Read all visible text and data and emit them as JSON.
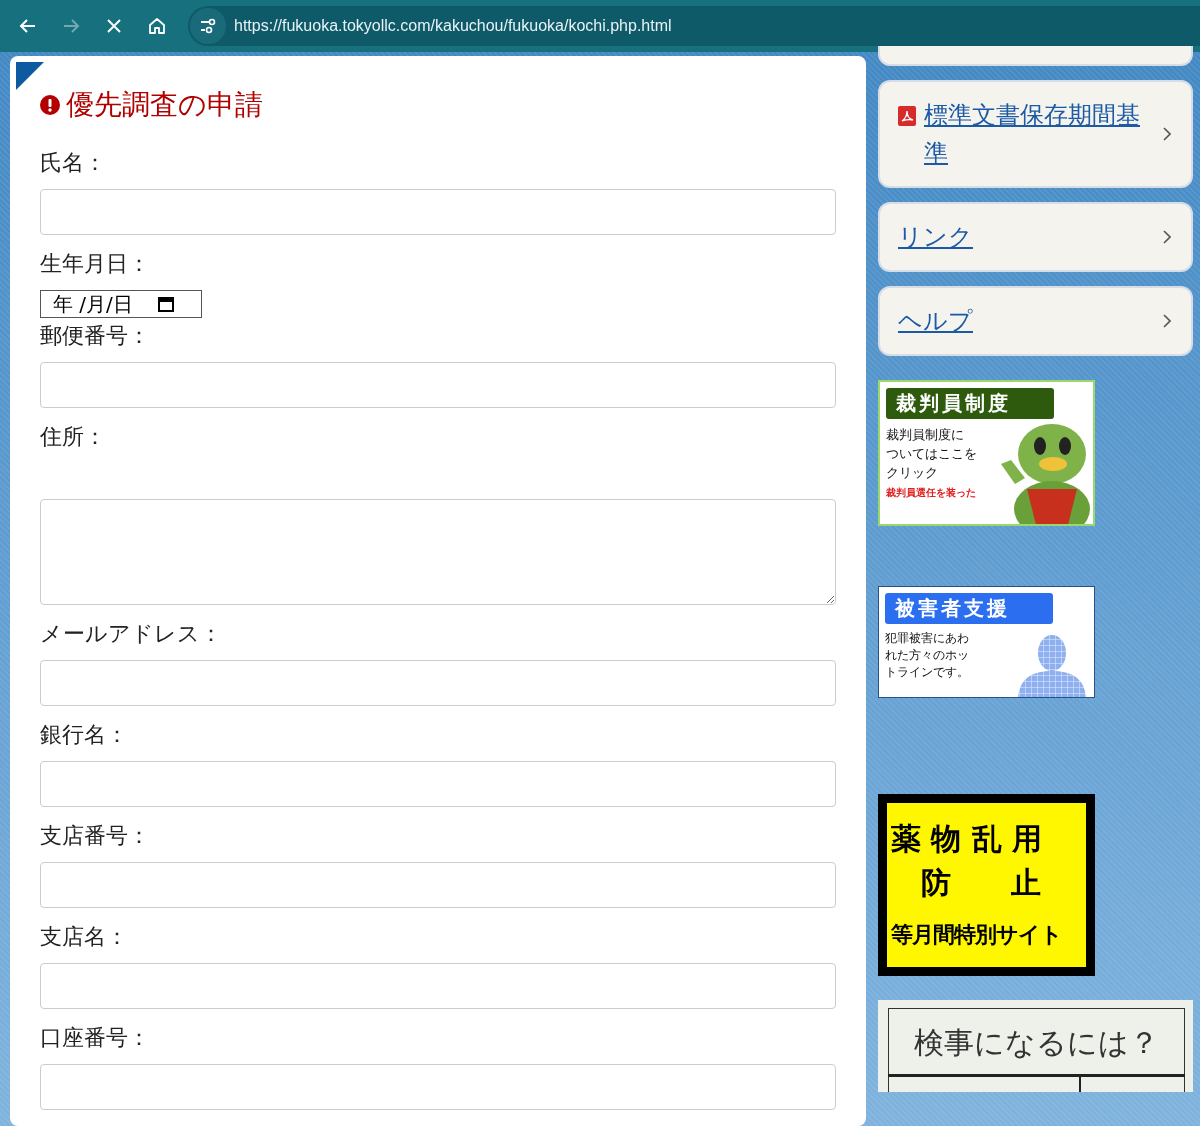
{
  "browser": {
    "url": "https://fukuoka.tokyollc.com/kakuchou/fukuoka/kochi.php.html",
    "forward_disabled": true
  },
  "form": {
    "title": "優先調査の申請",
    "fields": [
      {
        "label": "氏名：",
        "kind": "text"
      },
      {
        "label": "生年月日：",
        "kind": "date",
        "placeholder": "年 /月/日"
      },
      {
        "label": "郵便番号：",
        "kind": "text"
      },
      {
        "label": "住所：",
        "kind": "textarea"
      },
      {
        "label": "メールアドレス：",
        "kind": "text"
      },
      {
        "label": "銀行名：",
        "kind": "text"
      },
      {
        "label": "支店番号：",
        "kind": "text"
      },
      {
        "label": "支店名：",
        "kind": "text"
      },
      {
        "label": "口座番号：",
        "kind": "text"
      }
    ]
  },
  "sidebar": {
    "links": [
      {
        "label": "標準文書保存期間基準",
        "kind": "pdf"
      },
      {
        "label": "リンク",
        "kind": "plain"
      },
      {
        "label": "ヘルプ",
        "kind": "plain"
      }
    ],
    "banners": [
      {
        "kind": "mascot",
        "title": "裁判員制度",
        "lines": [
          "裁判員制度に",
          "ついてはここを",
          "クリック"
        ],
        "note": "裁判員選任を装った"
      },
      {
        "kind": "silhouette",
        "title": "被害者支援",
        "lines": [
          "犯罪被害にあわ",
          "れた方々のホッ",
          "トラインです。"
        ]
      },
      {
        "kind": "poster",
        "lines": [
          "薬 物 乱 用",
          "防　　止",
          "等月間特別サイト"
        ]
      },
      {
        "kind": "table",
        "title": "検事になるには？"
      }
    ]
  }
}
